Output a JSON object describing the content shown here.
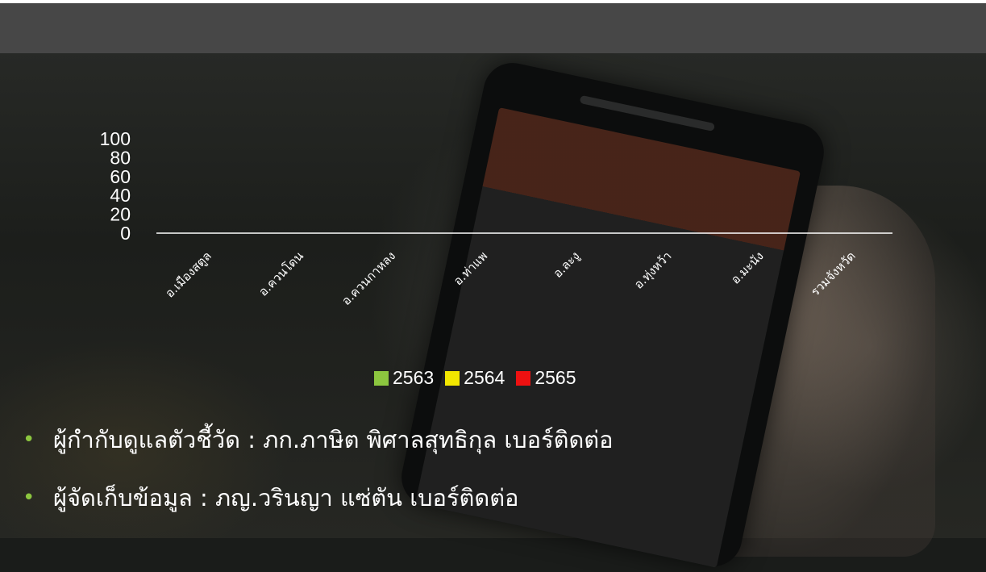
{
  "chart_data": {
    "type": "bar",
    "title": "",
    "xlabel": "",
    "ylabel": "",
    "ylim": [
      0,
      100
    ],
    "yticks": [
      "0",
      "20",
      "40",
      "60",
      "80",
      "100"
    ],
    "categories": [
      "อ.เมืองสตูล",
      "อ.ควนโดน",
      "อ.ควนกาหลง",
      "อ.ท่าแพ",
      "อ.ละงู",
      "อ.ทุ่งหว้า",
      "อ.มะนัง",
      "รวมจังหวัด"
    ],
    "series": [
      {
        "name": "2563",
        "color": "#8cc63f",
        "values": [
          0,
          0,
          0,
          0,
          0,
          0,
          0,
          0
        ]
      },
      {
        "name": "2564",
        "color": "#f2e600",
        "values": [
          0,
          0,
          0,
          0,
          0,
          0,
          0,
          0
        ]
      },
      {
        "name": "2565",
        "color": "#ee1111",
        "values": [
          0,
          0,
          0,
          0,
          0,
          0,
          0,
          0
        ]
      }
    ],
    "grid": false,
    "legend": "bottom"
  },
  "bullets": [
    "ผู้กำกับดูแลตัวชี้วัด :  ภก.ภาษิต  พิศาลสุทธิกุล เบอร์ติดต่อ",
    "ผู้จัดเก็บข้อมูล : ภญ.วรินญา แซ่ตัน เบอร์ติดต่อ"
  ],
  "colors": {
    "header_bar": "#474747",
    "bullet": "#8cc63f",
    "text": "#ffffff"
  }
}
